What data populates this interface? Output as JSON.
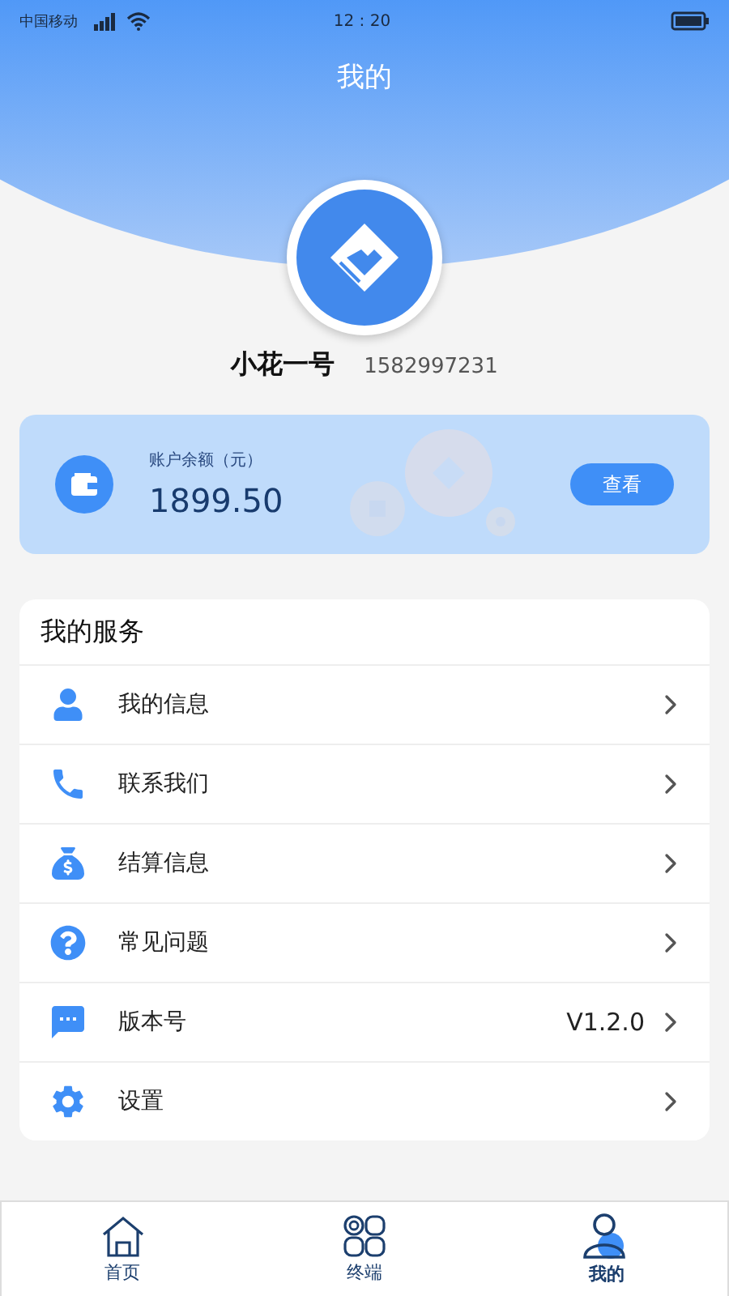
{
  "status_bar": {
    "carrier": "中国移动",
    "time": "12 : 20"
  },
  "header": {
    "title": "我的"
  },
  "profile": {
    "name": "小花一号",
    "phone": "1582997231"
  },
  "balance": {
    "label": "账户余额（元）",
    "amount": "1899.50",
    "button": "查看"
  },
  "services": {
    "title": "我的服务",
    "items": [
      {
        "kind": "user",
        "label": "我的信息"
      },
      {
        "kind": "phone",
        "label": "联系我们"
      },
      {
        "kind": "money",
        "label": "结算信息"
      },
      {
        "kind": "question",
        "label": "常见问题"
      },
      {
        "kind": "message",
        "label": "版本号",
        "value": "V1.2.0"
      },
      {
        "kind": "settings",
        "label": "设置"
      }
    ]
  },
  "tab_bar": [
    {
      "kind": "home",
      "label": "首页",
      "selected": false
    },
    {
      "kind": "grid",
      "label": "终端",
      "selected": false
    },
    {
      "kind": "person",
      "label": "我的",
      "selected": true
    }
  ]
}
